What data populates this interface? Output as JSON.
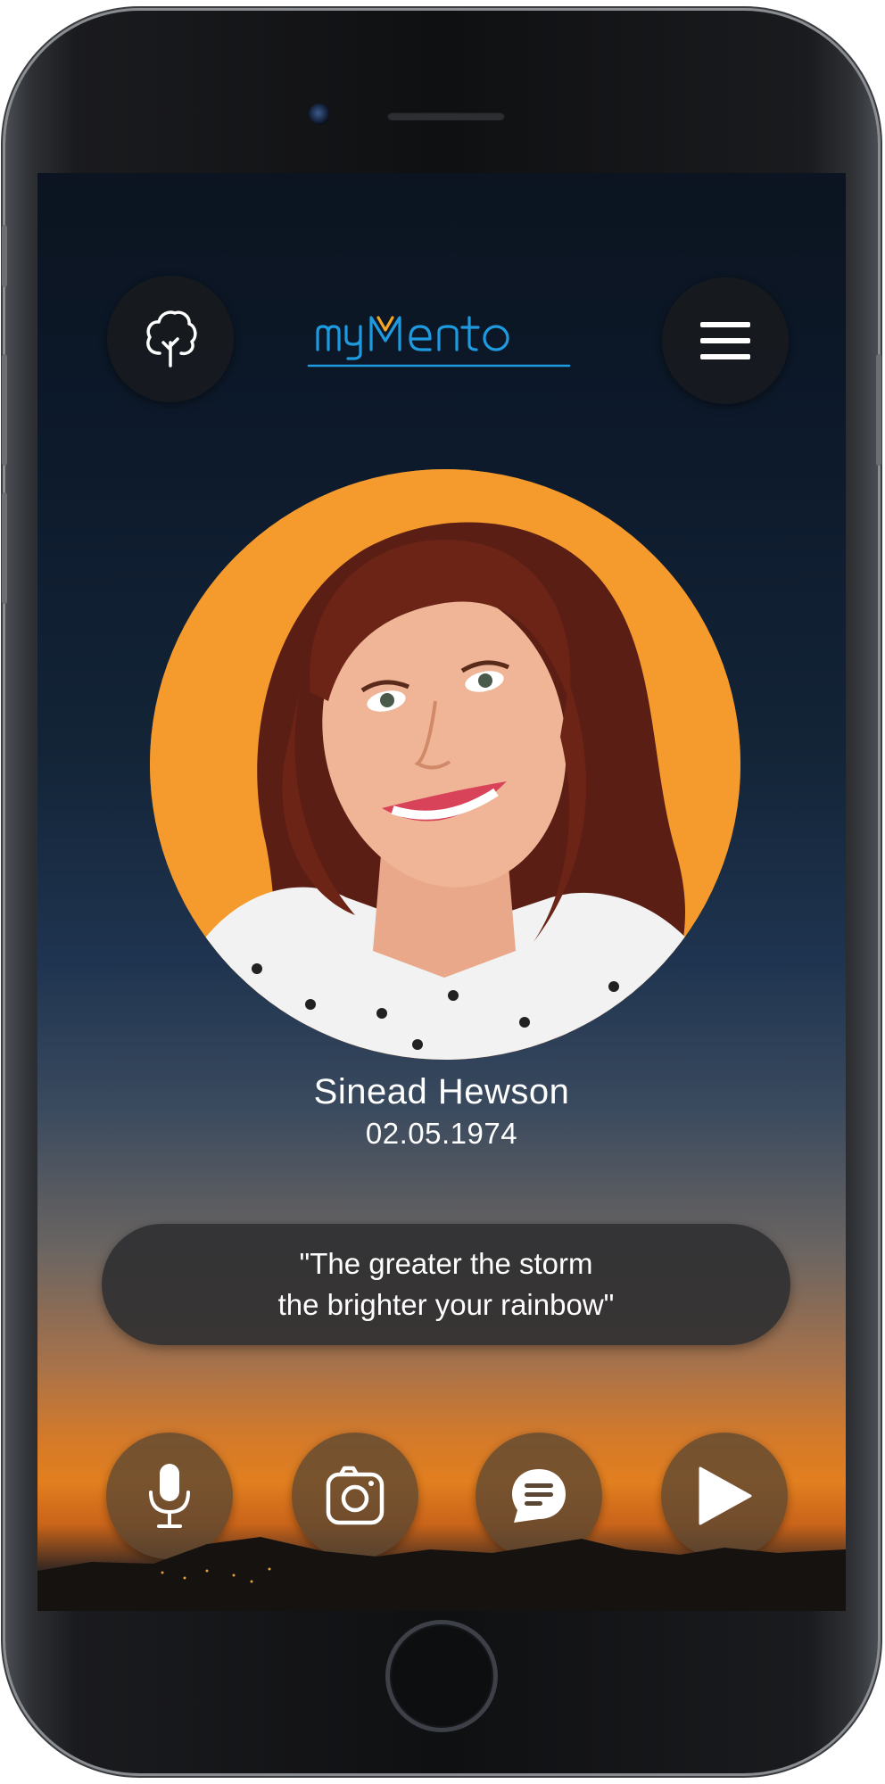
{
  "header": {
    "logo_text": "myMento",
    "logo_color": "#1e9be0",
    "logo_accent_color": "#f5a623",
    "left_button_icon": "tree-icon",
    "right_button_icon": "hamburger-menu-icon"
  },
  "profile": {
    "name": "Sinead Hewson",
    "date": "02.05.1974",
    "portrait_background": "#f59a2c"
  },
  "quote": {
    "line1": "\"The greater the storm",
    "line2": "the brighter your rainbow\""
  },
  "actions": [
    {
      "icon": "microphone-icon"
    },
    {
      "icon": "camera-icon"
    },
    {
      "icon": "chat-bubble-icon"
    },
    {
      "icon": "play-icon"
    }
  ]
}
